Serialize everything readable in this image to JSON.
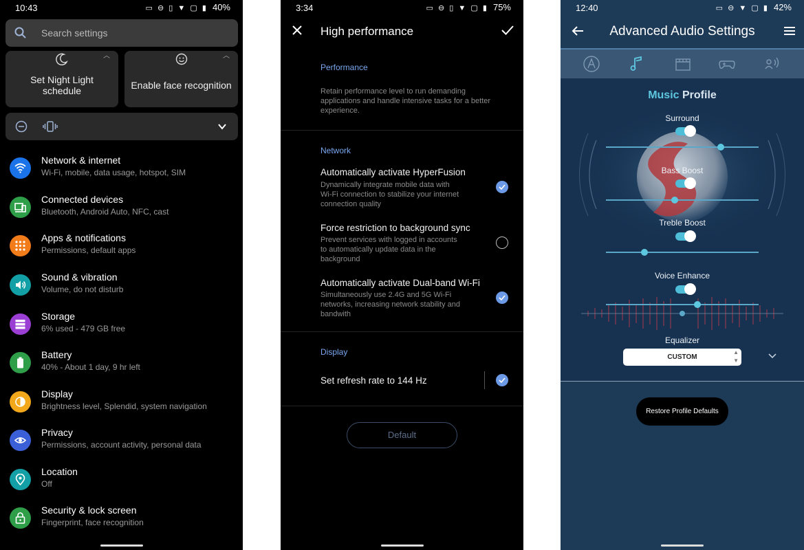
{
  "panel1": {
    "status": {
      "time": "10:43",
      "battery": "40%"
    },
    "search": {
      "placeholder": "Search settings"
    },
    "tiles": [
      {
        "label_line1": "Set Night Light",
        "label_line2": "schedule"
      },
      {
        "label": "Enable face recognition"
      }
    ],
    "items": [
      {
        "title": "Network & internet",
        "subtitle": "Wi-Fi, mobile, data usage, hotspot, SIM",
        "color": "#1a73e8",
        "icon": "wifi-icon"
      },
      {
        "title": "Connected devices",
        "subtitle": "Bluetooth, Android Auto, NFC, cast",
        "color": "#2e9e49",
        "icon": "devices-icon"
      },
      {
        "title": "Apps & notifications",
        "subtitle": "Permissions, default apps",
        "color": "#f27b1a",
        "icon": "apps-icon"
      },
      {
        "title": "Sound & vibration",
        "subtitle": "Volume, do not disturb",
        "color": "#12a0a6",
        "icon": "volume-icon"
      },
      {
        "title": "Storage",
        "subtitle": "6% used - 479 GB free",
        "color": "#9b3fd4",
        "icon": "storage-icon"
      },
      {
        "title": "Battery",
        "subtitle": "40% - About 1 day, 9 hr left",
        "color": "#2e9e49",
        "icon": "battery-icon"
      },
      {
        "title": "Display",
        "subtitle": "Brightness level, Splendid, system navigation",
        "color": "#f2a81a",
        "icon": "display-icon"
      },
      {
        "title": "Privacy",
        "subtitle": "Permissions, account activity, personal data",
        "color": "#3b5fd6",
        "icon": "privacy-eye-icon"
      },
      {
        "title": "Location",
        "subtitle": "Off",
        "color": "#12a0a6",
        "icon": "location-pin-icon"
      },
      {
        "title": "Security & lock screen",
        "subtitle": "Fingerprint, face recognition",
        "color": "#2e9e49",
        "icon": "lock-icon"
      }
    ]
  },
  "panel2": {
    "status": {
      "time": "3:34",
      "battery": "75%"
    },
    "title": "High performance",
    "performance": {
      "header": "Performance",
      "desc_line1": "Retain performance level to run demanding",
      "desc_line2": "applications and handle intensive tasks for a better",
      "desc_line3": "experience."
    },
    "network": {
      "header": "Network",
      "options": [
        {
          "title": "Automatically activate HyperFusion",
          "desc_line1": "Dynamically integrate mobile data with",
          "desc_line2": "Wi-Fi connection to stabilize your internet",
          "desc_line3": "connection quality",
          "checked": true
        },
        {
          "title": "Force restriction to background sync",
          "desc_line1": "Prevent services with logged in accounts",
          "desc_line2": "to automatically update data in the",
          "desc_line3": "background",
          "checked": false
        },
        {
          "title": "Automatically activate Dual-band Wi-Fi",
          "desc_line1": "Simultaneously use 2.4G and 5G Wi-Fi",
          "desc_line2": "networks, increasing network stability and",
          "desc_line3": "bandwith",
          "checked": true
        }
      ]
    },
    "display": {
      "header": "Display",
      "option": {
        "title": "Set refresh rate to 144 Hz",
        "checked": true
      }
    },
    "default_button": "Default"
  },
  "panel3": {
    "status": {
      "time": "12:40",
      "battery": "42%"
    },
    "title": "Advanced Audio Settings",
    "profile_title_highlight": "Music",
    "profile_title_rest": "Profile",
    "controls": [
      {
        "label": "Surround",
        "enabled": true,
        "level": 0.75
      },
      {
        "label": "Bass Boost",
        "enabled": true,
        "level": 0.45
      },
      {
        "label": "Treble Boost",
        "enabled": true,
        "level": 0.25
      },
      {
        "label": "Voice Enhance",
        "enabled": true,
        "level": 0.6
      }
    ],
    "equalizer": {
      "label": "Equalizer",
      "selected": "CUSTOM"
    },
    "restore_button": "Restore Profile Defaults",
    "accent_color": "#5ec7e0"
  }
}
